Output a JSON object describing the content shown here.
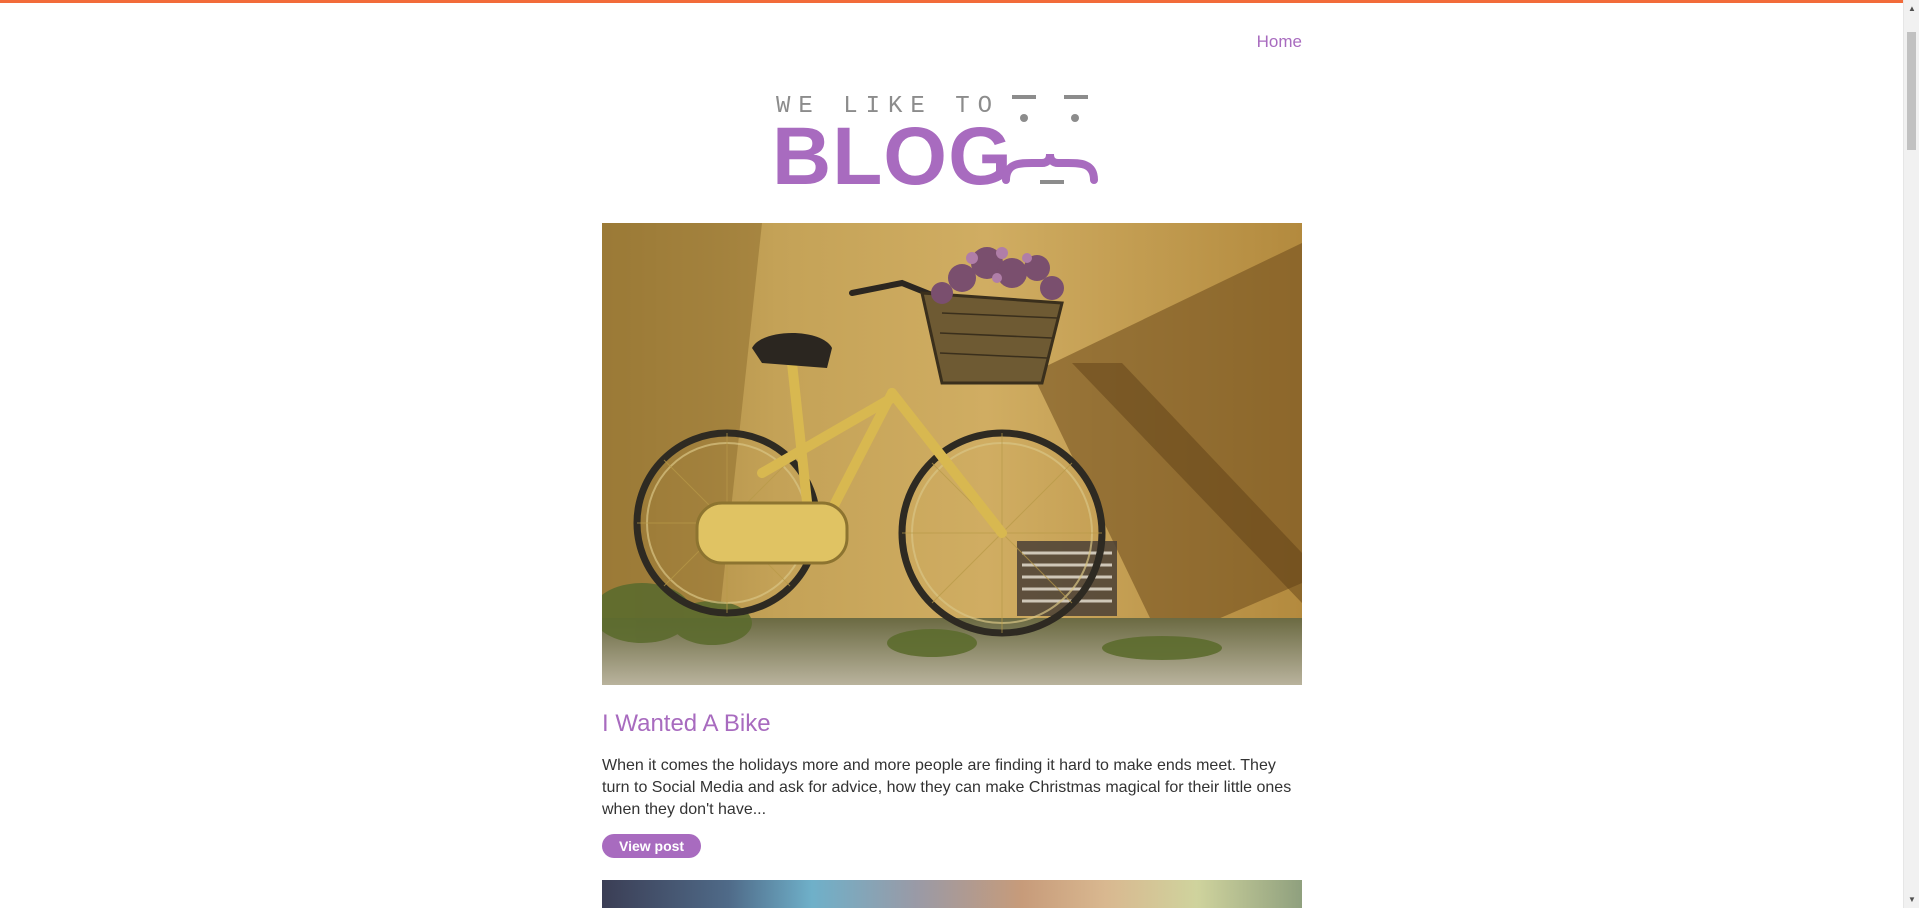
{
  "nav": {
    "home_label": "Home"
  },
  "logo": {
    "tagline": "WE LIKE TO",
    "word": "BLOG"
  },
  "colors": {
    "accent": "#a86bbf",
    "top_bar": "#f26b3a",
    "text": "#333333"
  },
  "posts": [
    {
      "image_icon": "bicycle-photo",
      "title": "I Wanted A Bike",
      "excerpt": "When it comes the holidays more and more people are finding it hard to make ends meet. They turn to Social Media and ask for advice, how they can make Christmas magical for their little ones when they don't have...",
      "button_label": "View post"
    }
  ],
  "scrollbar": {
    "up_icon": "triangle-up",
    "down_icon": "triangle-down"
  }
}
